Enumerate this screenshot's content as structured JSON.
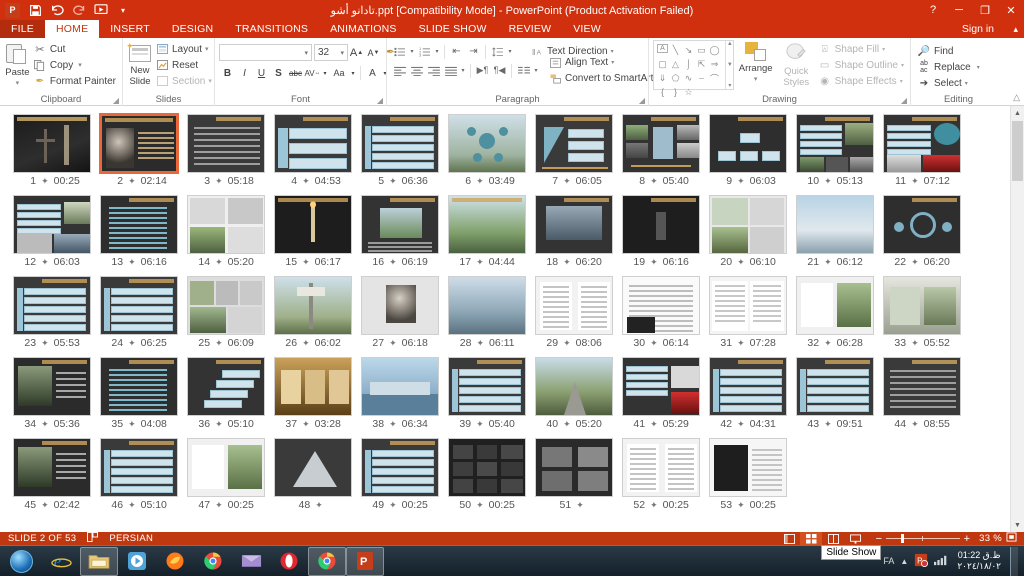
{
  "titlebar": {
    "title": "تادانو أشو.ppt [Compatibility Mode]  -  PowerPoint (Product Activation Failed)",
    "qat": [
      {
        "name": "powerpoint-logo",
        "label": "P"
      },
      {
        "name": "save-button",
        "label": "Ὃe"
      },
      {
        "name": "undo-button",
        "label": "↶"
      },
      {
        "name": "redo-button",
        "label": "↻"
      },
      {
        "name": "start-slideshow-button",
        "label": "▷"
      },
      {
        "name": "customize-qat-button",
        "label": "≡"
      }
    ],
    "help_label": "?",
    "minimize_label": "─",
    "restore_label": "❐",
    "close_label": "✕"
  },
  "tabs": [
    {
      "label": "FILE",
      "state": "file"
    },
    {
      "label": "HOME",
      "state": "active"
    },
    {
      "label": "INSERT",
      "state": "normal"
    },
    {
      "label": "DESIGN",
      "state": "normal"
    },
    {
      "label": "TRANSITIONS",
      "state": "normal"
    },
    {
      "label": "ANIMATIONS",
      "state": "normal"
    },
    {
      "label": "SLIDE SHOW",
      "state": "normal"
    },
    {
      "label": "REVIEW",
      "state": "normal"
    },
    {
      "label": "VIEW",
      "state": "normal"
    }
  ],
  "signin_label": "Sign in",
  "ribbon_collapse_label": "⌃",
  "ribbon": {
    "clipboard": {
      "group_label": "Clipboard",
      "paste_label": "Paste",
      "cut_label": "Cut",
      "copy_label": "Copy",
      "format_painter_label": "Format Painter"
    },
    "slides": {
      "group_label": "Slides",
      "new_slide_label": "New\nSlide",
      "new_slide_line1": "New",
      "new_slide_line2": "Slide",
      "layout_label": "Layout",
      "reset_label": "Reset",
      "section_label": "Section"
    },
    "font": {
      "group_label": "Font",
      "font_name_value": "",
      "font_name_placeholder": "",
      "font_size_value": "32",
      "grow_font_label": "A",
      "shrink_font_label": "A",
      "clear_formatting_label": "✐",
      "bold_label": "B",
      "italic_label": "I",
      "underline_label": "U",
      "shadow_label": "S",
      "strikethrough_label": "abc",
      "character_spacing_label": "AV",
      "change_case_label": "Aa",
      "font_color_label": "A"
    },
    "paragraph": {
      "group_label": "Paragraph",
      "bullets_label": "≣",
      "numbering_label": "≣",
      "decrease_indent_label": "⇤",
      "increase_indent_label": "⇥",
      "line_spacing_label": "↕",
      "align_left_label": "≡",
      "align_center_label": "≡",
      "align_right_label": "≡",
      "justify_label": "≡",
      "ltr_label": "▶¶",
      "rtl_label": "¶◀",
      "columns_label": "‖",
      "text_direction_label": "Text Direction",
      "align_text_label": "Align Text",
      "convert_smartart_label": "Convert to SmartArt"
    },
    "drawing": {
      "group_label": "Drawing",
      "arrange_label": "Arrange",
      "quick_styles_line1": "Quick",
      "quick_styles_line2": "Styles",
      "shape_fill_label": "Shape Fill",
      "shape_outline_label": "Shape Outline",
      "shape_effects_label": "Shape Effects",
      "shapes": [
        "A",
        "╲",
        "↘",
        "▭",
        "◯",
        "▢",
        "△",
        "⌙",
        "⤵",
        "⇨",
        "⇩",
        "⎔",
        "⌇",
        "⌒",
        "∿",
        "{",
        "}",
        "☆"
      ]
    },
    "editing": {
      "group_label": "Editing",
      "find_label": "Find",
      "replace_label": "Replace",
      "select_label": "Select"
    }
  },
  "slides": [
    {
      "num": "1",
      "time": "00:25",
      "style": "dark-photo-cross"
    },
    {
      "num": "2",
      "time": "02:14",
      "style": "portrait",
      "selected": true
    },
    {
      "num": "3",
      "time": "05:18",
      "style": "text-only"
    },
    {
      "num": "4",
      "time": "04:53",
      "style": "chevron-list"
    },
    {
      "num": "5",
      "time": "06:36",
      "style": "bullet-list"
    },
    {
      "num": "6",
      "time": "03:49",
      "style": "photo-diagram"
    },
    {
      "num": "7",
      "time": "06:05",
      "style": "funnel"
    },
    {
      "num": "8",
      "time": "05:40",
      "style": "photo-grid"
    },
    {
      "num": "9",
      "time": "06:03",
      "style": "org-chart"
    },
    {
      "num": "10",
      "time": "05:13",
      "style": "mixed-photos"
    },
    {
      "num": "11",
      "time": "07:12",
      "style": "mixed-photos2"
    },
    {
      "num": "12",
      "time": "06:03",
      "style": "bullets-photo"
    },
    {
      "num": "13",
      "time": "06:16",
      "style": "arabic-text"
    },
    {
      "num": "14",
      "time": "05:20",
      "style": "four-photo"
    },
    {
      "num": "15",
      "time": "06:17",
      "style": "dark-candle"
    },
    {
      "num": "16",
      "time": "06:19",
      "style": "landscape"
    },
    {
      "num": "17",
      "time": "04:44",
      "style": "nature"
    },
    {
      "num": "18",
      "time": "06:20",
      "style": "building"
    },
    {
      "num": "19",
      "time": "06:16",
      "style": "dark-figure"
    },
    {
      "num": "20",
      "time": "06:10",
      "style": "collage"
    },
    {
      "num": "21",
      "time": "06:12",
      "style": "sky"
    },
    {
      "num": "22",
      "time": "06:20",
      "style": "diagram-circle"
    },
    {
      "num": "23",
      "time": "05:53",
      "style": "bullet-list"
    },
    {
      "num": "24",
      "time": "06:25",
      "style": "bullet-list"
    },
    {
      "num": "25",
      "time": "06:09",
      "style": "photo-collage"
    },
    {
      "num": "26",
      "time": "06:02",
      "style": "road-sign"
    },
    {
      "num": "27",
      "time": "06:18",
      "style": "portrait2"
    },
    {
      "num": "28",
      "time": "06:11",
      "style": "water"
    },
    {
      "num": "29",
      "time": "08:06",
      "style": "white-doc"
    },
    {
      "num": "30",
      "time": "06:14",
      "style": "white-text"
    },
    {
      "num": "31",
      "time": "07:28",
      "style": "white-list"
    },
    {
      "num": "32",
      "time": "06:28",
      "style": "white-photo"
    },
    {
      "num": "33",
      "time": "05:52",
      "style": "interior"
    },
    {
      "num": "34",
      "time": "05:36",
      "style": "photo-dark"
    },
    {
      "num": "35",
      "time": "04:08",
      "style": "arabic-text"
    },
    {
      "num": "36",
      "time": "05:10",
      "style": "steps"
    },
    {
      "num": "37",
      "time": "03:28",
      "style": "interior-gold"
    },
    {
      "num": "38",
      "time": "06:34",
      "style": "bridge"
    },
    {
      "num": "39",
      "time": "05:40",
      "style": "bullet-list"
    },
    {
      "num": "40",
      "time": "05:20",
      "style": "road"
    },
    {
      "num": "41",
      "time": "05:29",
      "style": "red-photo"
    },
    {
      "num": "42",
      "time": "04:31",
      "style": "bullet-list"
    },
    {
      "num": "43",
      "time": "09:51",
      "style": "bullet-list"
    },
    {
      "num": "44",
      "time": "08:55",
      "style": "text-only"
    },
    {
      "num": "45",
      "time": "02:42",
      "style": "photo-dark"
    },
    {
      "num": "46",
      "time": "05:10",
      "style": "bullet-list"
    },
    {
      "num": "47",
      "time": "00:25",
      "style": "white-photo"
    },
    {
      "num": "48",
      "time": "",
      "style": "triangle"
    },
    {
      "num": "49",
      "time": "00:25",
      "style": "bullet-list"
    },
    {
      "num": "50",
      "time": "00:25",
      "style": "dark-grid"
    },
    {
      "num": "51",
      "time": "",
      "style": "dark-photos"
    },
    {
      "num": "52",
      "time": "00:25",
      "style": "white-doc"
    },
    {
      "num": "53",
      "time": "00:25",
      "style": "white-bw"
    }
  ],
  "status": {
    "slide_indicator": "SLIDE 2 OF 53",
    "notes_icon": "notes-icon",
    "language": "PERSIAN",
    "views": [
      {
        "name": "normal-view-button",
        "label": "▤",
        "active": false
      },
      {
        "name": "slide-sorter-view-button",
        "label": "☷",
        "active": true
      },
      {
        "name": "reading-view-button",
        "label": "▣",
        "active": false
      },
      {
        "name": "slideshow-view-button",
        "label": "☰",
        "active": false
      }
    ],
    "zoom_out_label": "−",
    "zoom_in_label": "+",
    "zoom_value": "33 %",
    "fit_label": "⛶"
  },
  "taskbar": {
    "start_label": "",
    "items": [
      {
        "name": "internet-explorer-taskbar-icon",
        "label": "e",
        "color": "#1f6fb0"
      },
      {
        "name": "file-explorer-taskbar-icon",
        "label": "▰",
        "color": "#e8c06a",
        "active": true
      },
      {
        "name": "media-player-taskbar-icon",
        "label": "▶",
        "color": "#4ea3d8"
      },
      {
        "name": "firefox-taskbar-icon",
        "label": "●",
        "color": "#e66000"
      },
      {
        "name": "chrome-taskbar-icon",
        "label": "◉",
        "color": "#4285f4"
      },
      {
        "name": "mail-taskbar-icon",
        "label": "✉",
        "color": "#8e7bc3"
      },
      {
        "name": "opera-taskbar-icon",
        "label": "O",
        "color": "#e0282e"
      },
      {
        "name": "chrome-window-taskbar-icon",
        "label": "◉",
        "color": "#4285f4",
        "active": true
      },
      {
        "name": "powerpoint-taskbar-icon",
        "label": "P",
        "color": "#c43e1c",
        "active": true
      }
    ],
    "tooltip": "Slide Show",
    "tray_fa_label": "FA",
    "clock_time": "01:22 ظ.ق",
    "clock_date": "٢٠٢٤/١٨/٠٢"
  }
}
